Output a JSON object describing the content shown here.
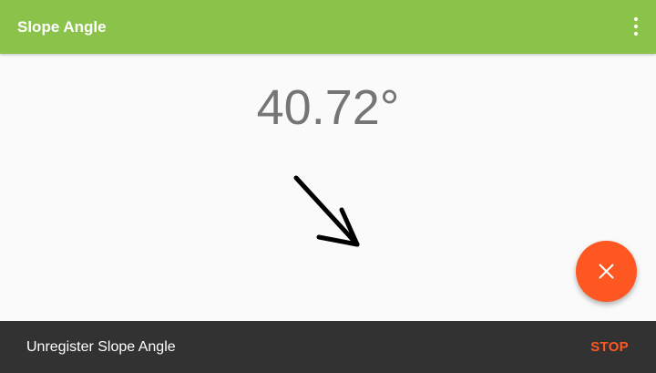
{
  "toolbar": {
    "title": "Slope Angle",
    "overflow_icon": "more-vert-icon",
    "background_color": "#8bc34a"
  },
  "main": {
    "angle_value": "40.72°",
    "arrow_icon": "arrow-down-right-icon",
    "arrow_angle_degrees": 40.72
  },
  "fab": {
    "icon": "close-icon",
    "color": "#ff5722"
  },
  "snackbar": {
    "message": "Unregister Slope Angle",
    "action_label": "STOP",
    "action_color": "#ff5722",
    "background_color": "#323232"
  }
}
